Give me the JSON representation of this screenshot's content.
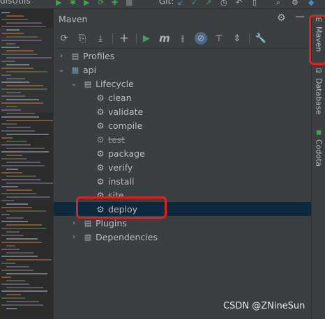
{
  "ide": {
    "file_tab": "disUtils",
    "git_label": "Git:"
  },
  "maven": {
    "title": "Maven",
    "toolbar": {
      "reload": "reload-icon",
      "add_sources": "generate-sources-icon",
      "download": "download-icon",
      "add": "+",
      "run": "▶",
      "execute_goal": "m",
      "toggle_offline": "toggle-offline-icon",
      "skip_tests": "skip-tests-icon",
      "show_deps": "show-dependencies-icon",
      "collapse": "collapse-all-icon",
      "settings": "wrench-icon"
    },
    "tree": {
      "profiles": "Profiles",
      "project": "api",
      "lifecycle": "Lifecycle",
      "goals": [
        "clean",
        "validate",
        "compile",
        "test",
        "package",
        "verify",
        "install",
        "site",
        "deploy"
      ],
      "plugins": "Plugins",
      "dependencies": "Dependencies"
    }
  },
  "stripe": {
    "maven": "Maven",
    "database": "Database",
    "codota": "Codota"
  },
  "watermark": "CSDN @ZNineSun",
  "colors": {
    "highlight": "#e0201b",
    "selected_row": "#0d293e",
    "run_green": "#499c54"
  }
}
